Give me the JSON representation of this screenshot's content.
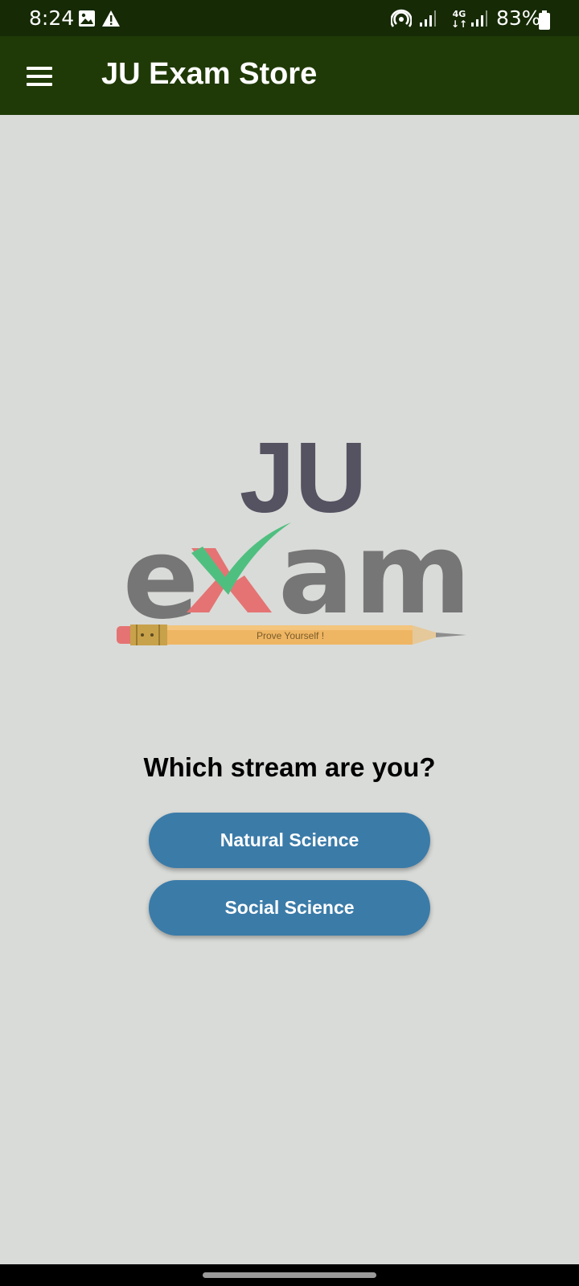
{
  "status_bar": {
    "time": "8:24",
    "battery": "83%",
    "network_type": "4G",
    "icons": [
      "image-icon",
      "warning-icon",
      "hotspot-icon",
      "signal-icon",
      "network-4g-icon",
      "signal-icon",
      "battery-icon"
    ]
  },
  "app_bar": {
    "title": "JU Exam Store",
    "menu_icon": "hamburger-menu-icon"
  },
  "logo": {
    "top_text": "JU",
    "main_text": "exam",
    "tagline": "Prove Yourself !",
    "colors": {
      "ju": "#555261",
      "exam": "#767676",
      "x_red": "#e57373",
      "check_green": "#4fbf80",
      "pencil": "#eeb563"
    }
  },
  "main": {
    "prompt": "Which stream are you?",
    "buttons": [
      "Natural Science",
      "Social Science"
    ]
  },
  "colors": {
    "status_bar": "#152a05",
    "app_bar": "#1f3a06",
    "background": "#d9dbd8",
    "button": "#3b7ba8"
  }
}
